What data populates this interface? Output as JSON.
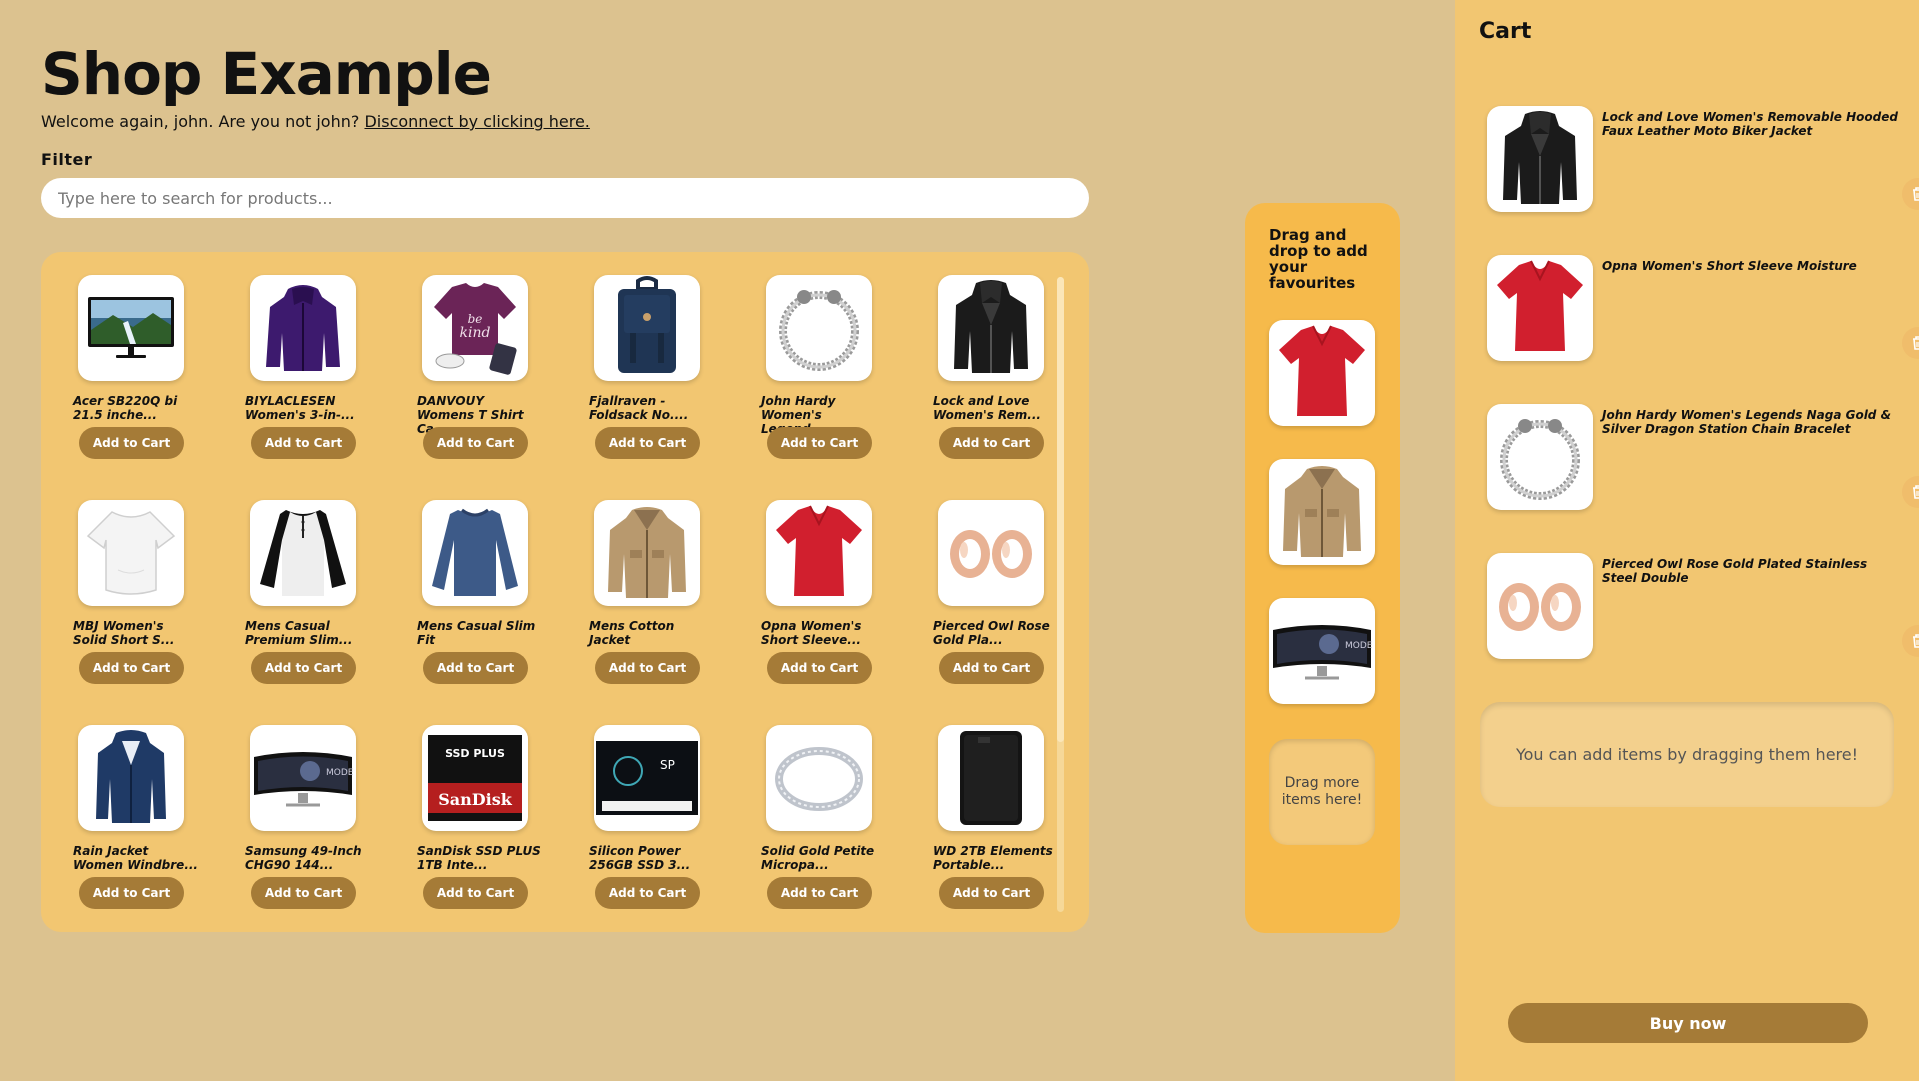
{
  "header": {
    "title": "Shop Example",
    "welcome_text": "Welcome again, john. Are you not john?",
    "disconnect_link": "Disconnect by clicking here."
  },
  "filter": {
    "label": "Filter",
    "placeholder": "Type here to search for products..."
  },
  "products": {
    "add_label": "Add to Cart",
    "items": [
      {
        "name": "Acer SB220Q bi 21.5 inche...",
        "icon": "monitor-icon"
      },
      {
        "name": "BIYLACLESEN Women's 3-in-...",
        "icon": "jacket-purple-icon"
      },
      {
        "name": "DANVOUY Womens T Shirt Ca...",
        "icon": "tshirt-purple-icon"
      },
      {
        "name": "Fjallraven - Foldsack No....",
        "icon": "backpack-icon"
      },
      {
        "name": "John Hardy Women's Legend...",
        "icon": "bracelet-chain-icon"
      },
      {
        "name": "Lock and Love Women's Rem...",
        "icon": "leather-jacket-icon"
      },
      {
        "name": "MBJ Women's Solid Short S...",
        "icon": "top-white-icon"
      },
      {
        "name": "Mens Casual Premium Slim...",
        "icon": "raglan-tee-icon"
      },
      {
        "name": "Mens Casual Slim Fit",
        "icon": "longsleeve-blue-icon"
      },
      {
        "name": "Mens Cotton Jacket",
        "icon": "cotton-jacket-icon"
      },
      {
        "name": "Opna Women's Short Sleeve...",
        "icon": "tshirt-red-icon"
      },
      {
        "name": "Pierced Owl Rose Gold Pla...",
        "icon": "rose-gold-plugs-icon"
      },
      {
        "name": "Rain Jacket Women Windbre...",
        "icon": "rain-jacket-icon"
      },
      {
        "name": "Samsung 49-Inch CHG90 144...",
        "icon": "curved-monitor-icon"
      },
      {
        "name": "SanDisk SSD PLUS 1TB Inte...",
        "icon": "ssd-sandisk-icon"
      },
      {
        "name": "Silicon Power 256GB SSD 3...",
        "icon": "ssd-silicon-icon"
      },
      {
        "name": "Solid Gold Petite Micropa...",
        "icon": "ring-bracelet-icon"
      },
      {
        "name": "WD 2TB Elements Portable...",
        "icon": "hard-drive-icon"
      }
    ]
  },
  "favourites": {
    "title": "Drag and drop to add your favourites",
    "items": [
      "tshirt-red-icon",
      "cotton-jacket-icon",
      "curved-monitor-icon"
    ],
    "drop_text": "Drag more items here!"
  },
  "cart": {
    "title": "Cart",
    "items": [
      {
        "name": "Lock and Love Women's Removable Hooded Faux Leather Moto Biker Jacket",
        "icon": "leather-jacket-icon"
      },
      {
        "name": "Opna Women's Short Sleeve Moisture",
        "icon": "tshirt-red-icon"
      },
      {
        "name": "John Hardy Women's Legends Naga Gold & Silver Dragon Station Chain Bracelet",
        "icon": "bracelet-chain-icon"
      },
      {
        "name": "Pierced Owl Rose Gold Plated Stainless Steel Double",
        "icon": "rose-gold-plugs-icon"
      }
    ],
    "drop_text": "You can add items by dragging them here!",
    "buy_label": "Buy now"
  },
  "colors": {
    "background": "#dcc28f",
    "panel": "#f2c671",
    "favourites_panel": "#f6ba4b",
    "button": "#a57b37"
  }
}
